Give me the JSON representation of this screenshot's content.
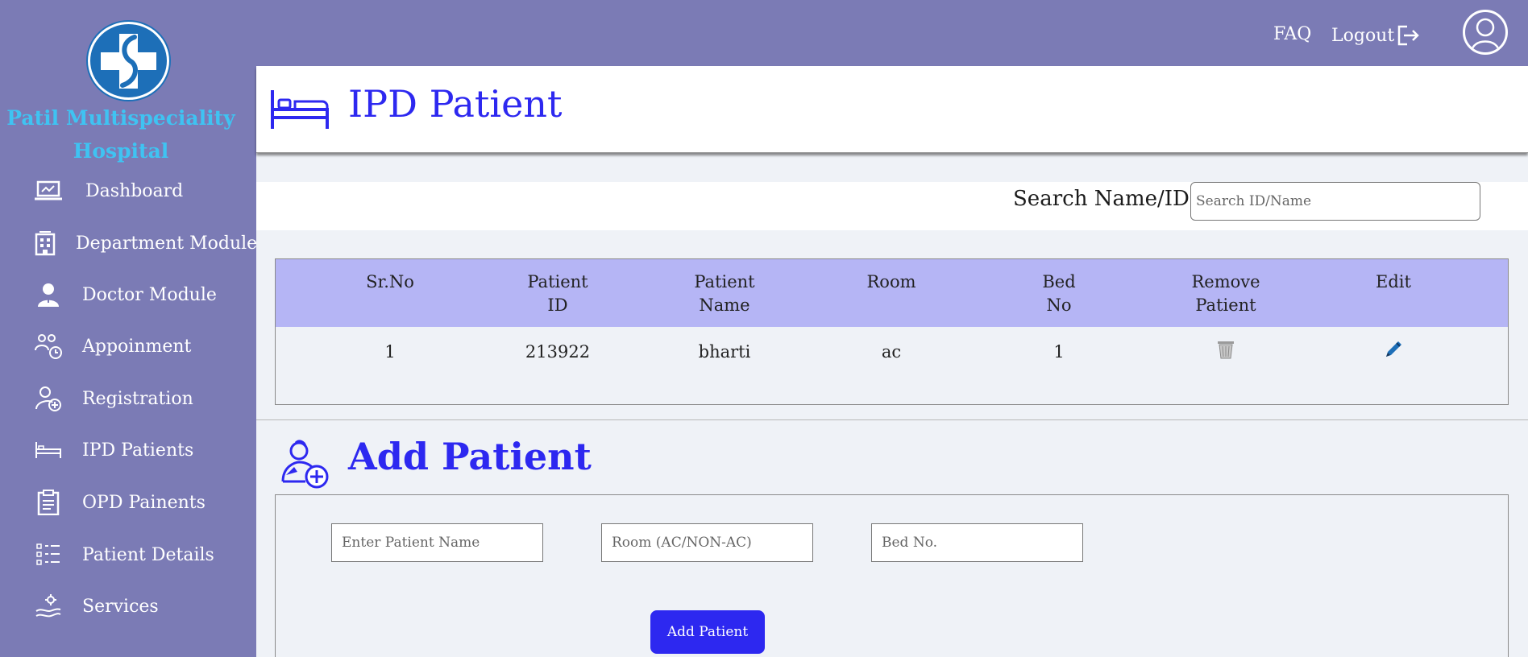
{
  "sidebar": {
    "hospital_name_line1": "Patil Multispeciality",
    "hospital_name_line2": "Hospital",
    "items": [
      {
        "label": "Dashboard",
        "icon": "laptop-chart-icon"
      },
      {
        "label": "Department Module",
        "icon": "building-icon"
      },
      {
        "label": "Doctor Module",
        "icon": "doctor-icon"
      },
      {
        "label": "Appoinment",
        "icon": "people-clock-icon"
      },
      {
        "label": "Registration",
        "icon": "user-plus-icon"
      },
      {
        "label": "IPD Patients",
        "icon": "bed-icon"
      },
      {
        "label": "OPD Painents",
        "icon": "clipboard-icon"
      },
      {
        "label": "Patient Details",
        "icon": "list-icon"
      },
      {
        "label": "Services",
        "icon": "hand-gear-icon"
      }
    ]
  },
  "header": {
    "faq": "FAQ",
    "logout": "Logout"
  },
  "page": {
    "title": "IPD Patient"
  },
  "search": {
    "label": "Search Name/ID :",
    "placeholder": "Search ID/Name"
  },
  "table": {
    "headers": [
      [
        "Sr.No",
        ""
      ],
      [
        "Patient",
        "ID"
      ],
      [
        "Patient",
        "Name"
      ],
      [
        "Room",
        ""
      ],
      [
        "Bed",
        "No"
      ],
      [
        "Remove",
        "Patient"
      ],
      [
        "Edit",
        ""
      ]
    ],
    "rows": [
      {
        "srno": "1",
        "patient_id": "213922",
        "name": "bharti",
        "room": "ac",
        "bed": "1"
      }
    ]
  },
  "add_patient": {
    "title": "Add Patient",
    "name_placeholder": "Enter Patient Name",
    "room_placeholder": "Room (AC/NON-AC)",
    "bed_placeholder": "Bed No.",
    "button": "Add Patient"
  },
  "colors": {
    "sidebar": "#7b7bb5",
    "accent": "#2d28f0",
    "hospital_name": "#3fc3f2",
    "table_header": "#b5b5f5"
  }
}
